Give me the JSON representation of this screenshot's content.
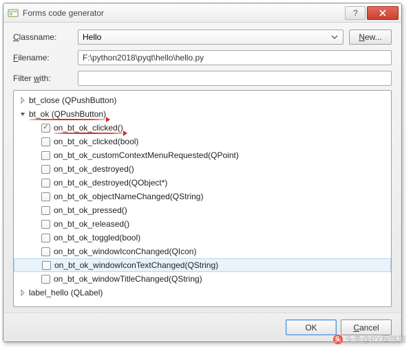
{
  "window": {
    "title": "Forms code generator"
  },
  "form": {
    "classname_label": "Classname:",
    "classname_value": "Hello",
    "new_button": "New...",
    "filename_label": "Filename:",
    "filename_value": "F:\\python2018\\pyqt\\hello\\hello.py",
    "filter_label": "Filter with:",
    "filter_value": ""
  },
  "tree": {
    "items": [
      {
        "level": 0,
        "expander": "collapsed",
        "label": "bt_close (QPushButton)"
      },
      {
        "level": 0,
        "expander": "expanded",
        "label": "bt_ok (QPushButton)",
        "underline": true
      },
      {
        "level": 1,
        "checkbox": true,
        "checked": true,
        "label": "on_bt_ok_clicked()",
        "underline": true
      },
      {
        "level": 1,
        "checkbox": true,
        "checked": false,
        "label": "on_bt_ok_clicked(bool)"
      },
      {
        "level": 1,
        "checkbox": true,
        "checked": false,
        "label": "on_bt_ok_customContextMenuRequested(QPoint)"
      },
      {
        "level": 1,
        "checkbox": true,
        "checked": false,
        "label": "on_bt_ok_destroyed()"
      },
      {
        "level": 1,
        "checkbox": true,
        "checked": false,
        "label": "on_bt_ok_destroyed(QObject*)"
      },
      {
        "level": 1,
        "checkbox": true,
        "checked": false,
        "label": "on_bt_ok_objectNameChanged(QString)"
      },
      {
        "level": 1,
        "checkbox": true,
        "checked": false,
        "label": "on_bt_ok_pressed()"
      },
      {
        "level": 1,
        "checkbox": true,
        "checked": false,
        "label": "on_bt_ok_released()"
      },
      {
        "level": 1,
        "checkbox": true,
        "checked": false,
        "label": "on_bt_ok_toggled(bool)"
      },
      {
        "level": 1,
        "checkbox": true,
        "checked": false,
        "label": "on_bt_ok_windowIconChanged(QIcon)"
      },
      {
        "level": 1,
        "checkbox": true,
        "checked": false,
        "label": "on_bt_ok_windowIconTextChanged(QString)",
        "selected": true
      },
      {
        "level": 1,
        "checkbox": true,
        "checked": false,
        "label": "on_bt_ok_windowTitleChanged(QString)"
      },
      {
        "level": 0,
        "expander": "collapsed",
        "label": "label_hello (QLabel)"
      }
    ]
  },
  "buttons": {
    "ok": "OK",
    "cancel": "Cancel"
  },
  "watermark": "头条@PY程序猿"
}
